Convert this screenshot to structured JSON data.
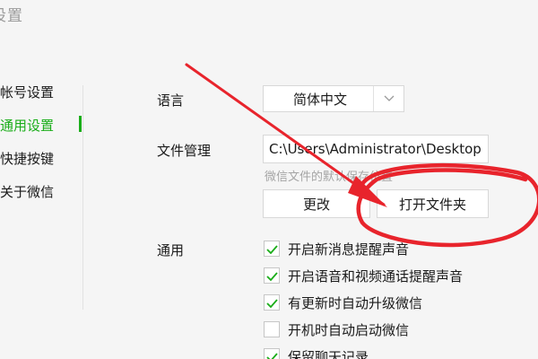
{
  "window": {
    "title": "设置"
  },
  "sidebar": {
    "items": [
      {
        "label": "帐号设置",
        "active": false
      },
      {
        "label": "通用设置",
        "active": true
      },
      {
        "label": "快捷按键",
        "active": false
      },
      {
        "label": "关于微信",
        "active": false
      }
    ]
  },
  "language": {
    "label": "语言",
    "value": "简体中文",
    "arrow_icon": "chevron-down-icon"
  },
  "file_management": {
    "label": "文件管理",
    "path": "C:\\Users\\Administrator\\Desktop",
    "hint": "微信文件的默认保存位置",
    "change_button": "更改",
    "open_folder_button": "打开文件夹"
  },
  "general": {
    "label": "通用",
    "options": [
      {
        "label": "开启新消息提醒声音",
        "checked": true
      },
      {
        "label": "开启语音和视频通话提醒声音",
        "checked": true
      },
      {
        "label": "有更新时自动升级微信",
        "checked": true
      },
      {
        "label": "开机时自动启动微信",
        "checked": false
      },
      {
        "label": "保留聊天记录",
        "checked": true
      }
    ]
  },
  "colors": {
    "accent": "#1aad19",
    "annotation": "#e8242c",
    "background": "#f5f5f5"
  }
}
